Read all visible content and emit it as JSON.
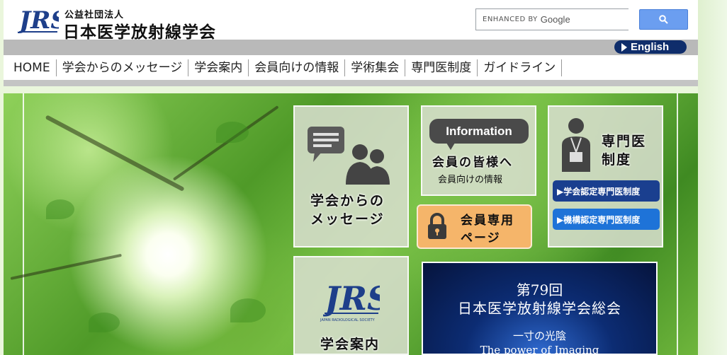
{
  "header": {
    "org_type": "公益社団法人",
    "org_name": "日本医学放射線学会",
    "logo_text": "JRS"
  },
  "search": {
    "enhanced_label": "ENHANCED BY",
    "google_label": "Google",
    "button_icon": "search-icon"
  },
  "language": {
    "english_label": "English"
  },
  "nav": {
    "items": [
      {
        "label": "HOME"
      },
      {
        "label": "学会からのメッセージ"
      },
      {
        "label": "学会案内"
      },
      {
        "label": "会員向けの情報"
      },
      {
        "label": "学術集会"
      },
      {
        "label": "専門医制度"
      },
      {
        "label": "ガイドライン"
      }
    ]
  },
  "tiles": {
    "message": {
      "line1": "学会からの",
      "line2": "メッセージ",
      "icon": "chat-people-icon"
    },
    "information": {
      "bubble": "Information",
      "title": "会員の皆様へ",
      "subtitle": "会員向けの情報"
    },
    "specialist": {
      "line1": "専門医",
      "line2": "制度",
      "icon": "id-badge-person-icon",
      "btn1": "▶学会認定専門医制度",
      "btn2": "▶機構認定専門医制度"
    },
    "members": {
      "line1": "会員専用",
      "line2": "ページ",
      "icon": "lock-icon"
    },
    "about": {
      "logo_text": "JRS",
      "logo_caption": "JAPAN RADIOLOGICAL SOCIETY",
      "label": "学会案内"
    }
  },
  "banner": {
    "title1": "第79回",
    "title2": "日本医学放射線学会総会",
    "sub1": "一寸の光陰",
    "sub2": "The power of Imaging"
  },
  "colors": {
    "english_bg": "#0f2d6b",
    "blue_btn1": "#1a3f8f",
    "blue_btn2": "#1e73d8",
    "member_tile": "#f5b56a",
    "search_btn": "#6b9ef0"
  }
}
